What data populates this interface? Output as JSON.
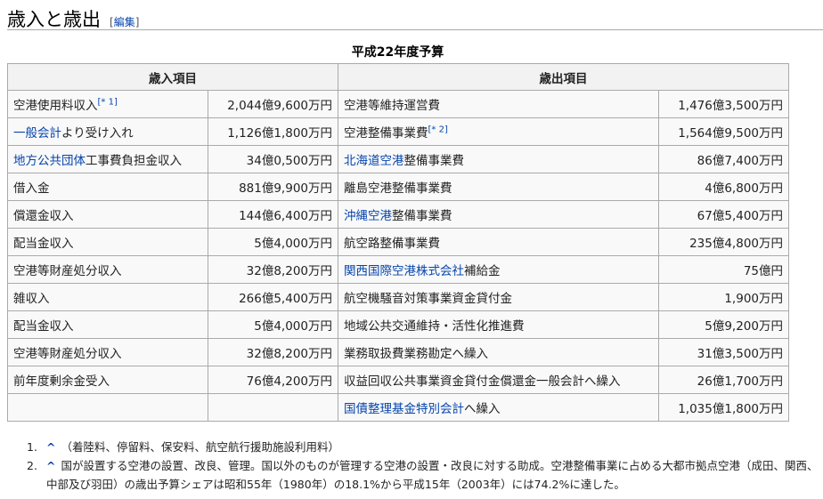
{
  "heading": {
    "title": "歳入と歳出",
    "edit_open": "[",
    "edit_label": "編集",
    "edit_close": "]"
  },
  "table": {
    "caption": "平成22年度予算",
    "headers": {
      "revenue": "歳入項目",
      "expenditure": "歳出項目"
    },
    "rows": [
      {
        "rev": [
          {
            "text": "空港使用料収入"
          }
        ],
        "rev_ref": "[* 1]",
        "rev_amt": "2,044億9,600万円",
        "exp": [
          {
            "text": "空港等維持運営費"
          }
        ],
        "exp_ref": "",
        "exp_amt": "1,476億3,500万円"
      },
      {
        "rev": [
          {
            "text": "一般会計",
            "link": true
          },
          {
            "text": "より受け入れ"
          }
        ],
        "rev_ref": "",
        "rev_amt": "1,126億1,800万円",
        "exp": [
          {
            "text": "空港整備事業費"
          }
        ],
        "exp_ref": "[* 2]",
        "exp_amt": "1,564億9,500万円"
      },
      {
        "rev": [
          {
            "text": "地方公共団体",
            "link": true
          },
          {
            "text": "工事費負担金収入"
          }
        ],
        "rev_ref": "",
        "rev_amt": "34億0,500万円",
        "exp": [
          {
            "text": "北海道空港",
            "link": true
          },
          {
            "text": "整備事業費"
          }
        ],
        "exp_ref": "",
        "exp_amt": "86億7,400万円"
      },
      {
        "rev": [
          {
            "text": "借入金"
          }
        ],
        "rev_ref": "",
        "rev_amt": "881億9,900万円",
        "exp": [
          {
            "text": "離島空港整備事業費"
          }
        ],
        "exp_ref": "",
        "exp_amt": "4億6,800万円"
      },
      {
        "rev": [
          {
            "text": "償還金収入"
          }
        ],
        "rev_ref": "",
        "rev_amt": "144億6,400万円",
        "exp": [
          {
            "text": "沖縄空港",
            "link": true
          },
          {
            "text": "整備事業費"
          }
        ],
        "exp_ref": "",
        "exp_amt": "67億5,400万円"
      },
      {
        "rev": [
          {
            "text": "配当金収入"
          }
        ],
        "rev_ref": "",
        "rev_amt": "5億4,000万円",
        "exp": [
          {
            "text": "航空路整備事業費"
          }
        ],
        "exp_ref": "",
        "exp_amt": "235億4,800万円"
      },
      {
        "rev": [
          {
            "text": "空港等財産処分収入"
          }
        ],
        "rev_ref": "",
        "rev_amt": "32億8,200万円",
        "exp": [
          {
            "text": "関西国際空港株式会社",
            "link": true
          },
          {
            "text": "補給金"
          }
        ],
        "exp_ref": "",
        "exp_amt": "75億円"
      },
      {
        "rev": [
          {
            "text": "雑収入"
          }
        ],
        "rev_ref": "",
        "rev_amt": "266億5,400万円",
        "exp": [
          {
            "text": "航空機騒音対策事業資金貸付金"
          }
        ],
        "exp_ref": "",
        "exp_amt": "1,900万円"
      },
      {
        "rev": [
          {
            "text": "配当金収入"
          }
        ],
        "rev_ref": "",
        "rev_amt": "5億4,000万円",
        "exp": [
          {
            "text": "地域公共交通維持・活性化推進費"
          }
        ],
        "exp_ref": "",
        "exp_amt": "5億9,200万円"
      },
      {
        "rev": [
          {
            "text": "空港等財産処分収入"
          }
        ],
        "rev_ref": "",
        "rev_amt": "32億8,200万円",
        "exp": [
          {
            "text": "業務取扱費業務勘定へ繰入"
          }
        ],
        "exp_ref": "",
        "exp_amt": "31億3,500万円"
      },
      {
        "rev": [
          {
            "text": "前年度剰余金受入"
          }
        ],
        "rev_ref": "",
        "rev_amt": "76億4,200万円",
        "exp": [
          {
            "text": "収益回収公共事業資金貸付金償還金一般会計へ繰入"
          }
        ],
        "exp_ref": "",
        "exp_amt": "26億1,700万円"
      },
      {
        "rev": [],
        "rev_ref": "",
        "rev_amt": "",
        "exp": [
          {
            "text": "国債整理基金特別会計",
            "link": true
          },
          {
            "text": "へ繰入"
          }
        ],
        "exp_ref": "",
        "exp_amt": "1,035億1,800万円"
      }
    ]
  },
  "notes": [
    {
      "num": "1.",
      "caret": "^",
      "text": "（着陸料、停留料、保安料、航空航行援助施設利用料）"
    },
    {
      "num": "2.",
      "caret": "^",
      "text": "国が設置する空港の設置、改良、管理。国以外のものが管理する空港の設置・改良に対する助成。空港整備事業に占める大都市拠点空港（成田、関西、中部及び羽田）の歳出予算シェアは昭和55年（1980年）の18.1%から平成15年（2003年）には74.2%に達した。"
    }
  ],
  "colors": {
    "link": "#0645ad",
    "border": "#aaaaaa",
    "header_bg": "#f2f2f2",
    "table_bg": "#f9f9f9"
  }
}
